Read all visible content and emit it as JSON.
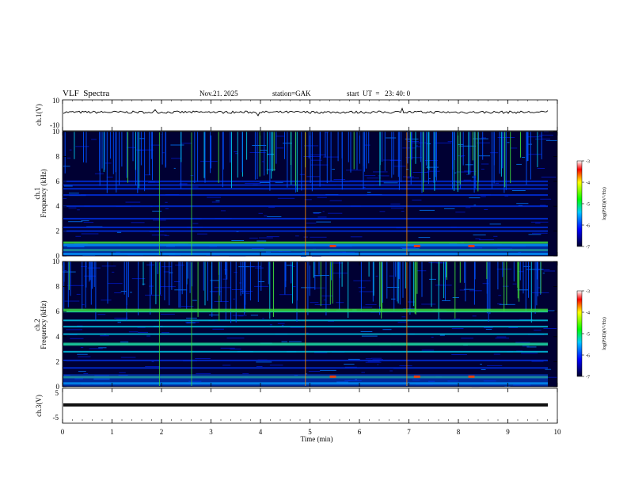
{
  "header": {
    "title": "VLF  Spectra",
    "date": "Nov.21. 2025",
    "station": "station=GAK",
    "start_time": "start  UT  =   23: 40: 0"
  },
  "panels": {
    "ch1_label": "ch.1(V)",
    "ch1_ticks": [
      "10",
      "-10"
    ],
    "spec1_label": "ch.1",
    "spec2_label": "ch.2",
    "freq_label": "Frequency  (kHz)",
    "freq_ticks": [
      "0",
      "2",
      "4",
      "6",
      "8",
      "10"
    ],
    "ch3_label": "ch.3(V)",
    "ch3_ticks": [
      "5",
      "-5"
    ],
    "colorbar_ticks": [
      "-3",
      "-4",
      "-5",
      "-6",
      "-7"
    ],
    "colorbar_label": "log(PSD)(V²/Hz)"
  },
  "colors": {
    "background": "#000033",
    "low": "#0000c8",
    "mid": "#00c8e6",
    "high": "#3cdc3c",
    "peak": "#ff3c00",
    "line_trace": "#000000"
  },
  "chart_data": [
    {
      "type": "line",
      "name": "ch1-waveform",
      "ylabel": "ch.1(V)",
      "ylim": [
        -10,
        10
      ],
      "x": [
        0,
        1,
        2,
        3,
        4,
        5,
        6,
        7,
        8,
        9,
        9.8
      ],
      "values": [
        2,
        2,
        2,
        2,
        2,
        2,
        2,
        2,
        2,
        2,
        2
      ]
    },
    {
      "type": "heatmap",
      "name": "ch1-spectrogram",
      "xlabel": "Time  (min)",
      "ylabel": "Frequency  (kHz)",
      "xlim": [
        0,
        10
      ],
      "ylim": [
        0,
        10
      ],
      "zlim": [
        -7,
        -3
      ],
      "zlabel": "log(PSD)(V²/Hz)",
      "bands_khz": [
        0.2,
        0.5,
        0.9,
        1.1,
        2.0,
        2.3,
        3.0,
        4.0,
        4.9,
        5.4,
        5.7,
        6.0
      ]
    },
    {
      "type": "heatmap",
      "name": "ch2-spectrogram",
      "xlabel": "Time  (min)",
      "ylabel": "Frequency  (kHz)",
      "xlim": [
        0,
        10
      ],
      "ylim": [
        0,
        10
      ],
      "zlim": [
        -7,
        -3
      ],
      "zlabel": "log(PSD)(V²/Hz)",
      "bands_khz": [
        0.3,
        0.8,
        1.5,
        2.1,
        2.8,
        3.4,
        4.2,
        4.8,
        5.3,
        6.0
      ]
    },
    {
      "type": "line",
      "name": "ch3-waveform",
      "ylabel": "ch.3(V)",
      "ylim": [
        -5,
        5
      ],
      "x": [
        0,
        9.8
      ],
      "values": [
        -2,
        -2
      ]
    }
  ],
  "time_axis": {
    "label": "Time  (min)",
    "ticks": [
      "0",
      "1",
      "2",
      "3",
      "4",
      "5",
      "6",
      "7",
      "8",
      "9",
      "10"
    ]
  }
}
